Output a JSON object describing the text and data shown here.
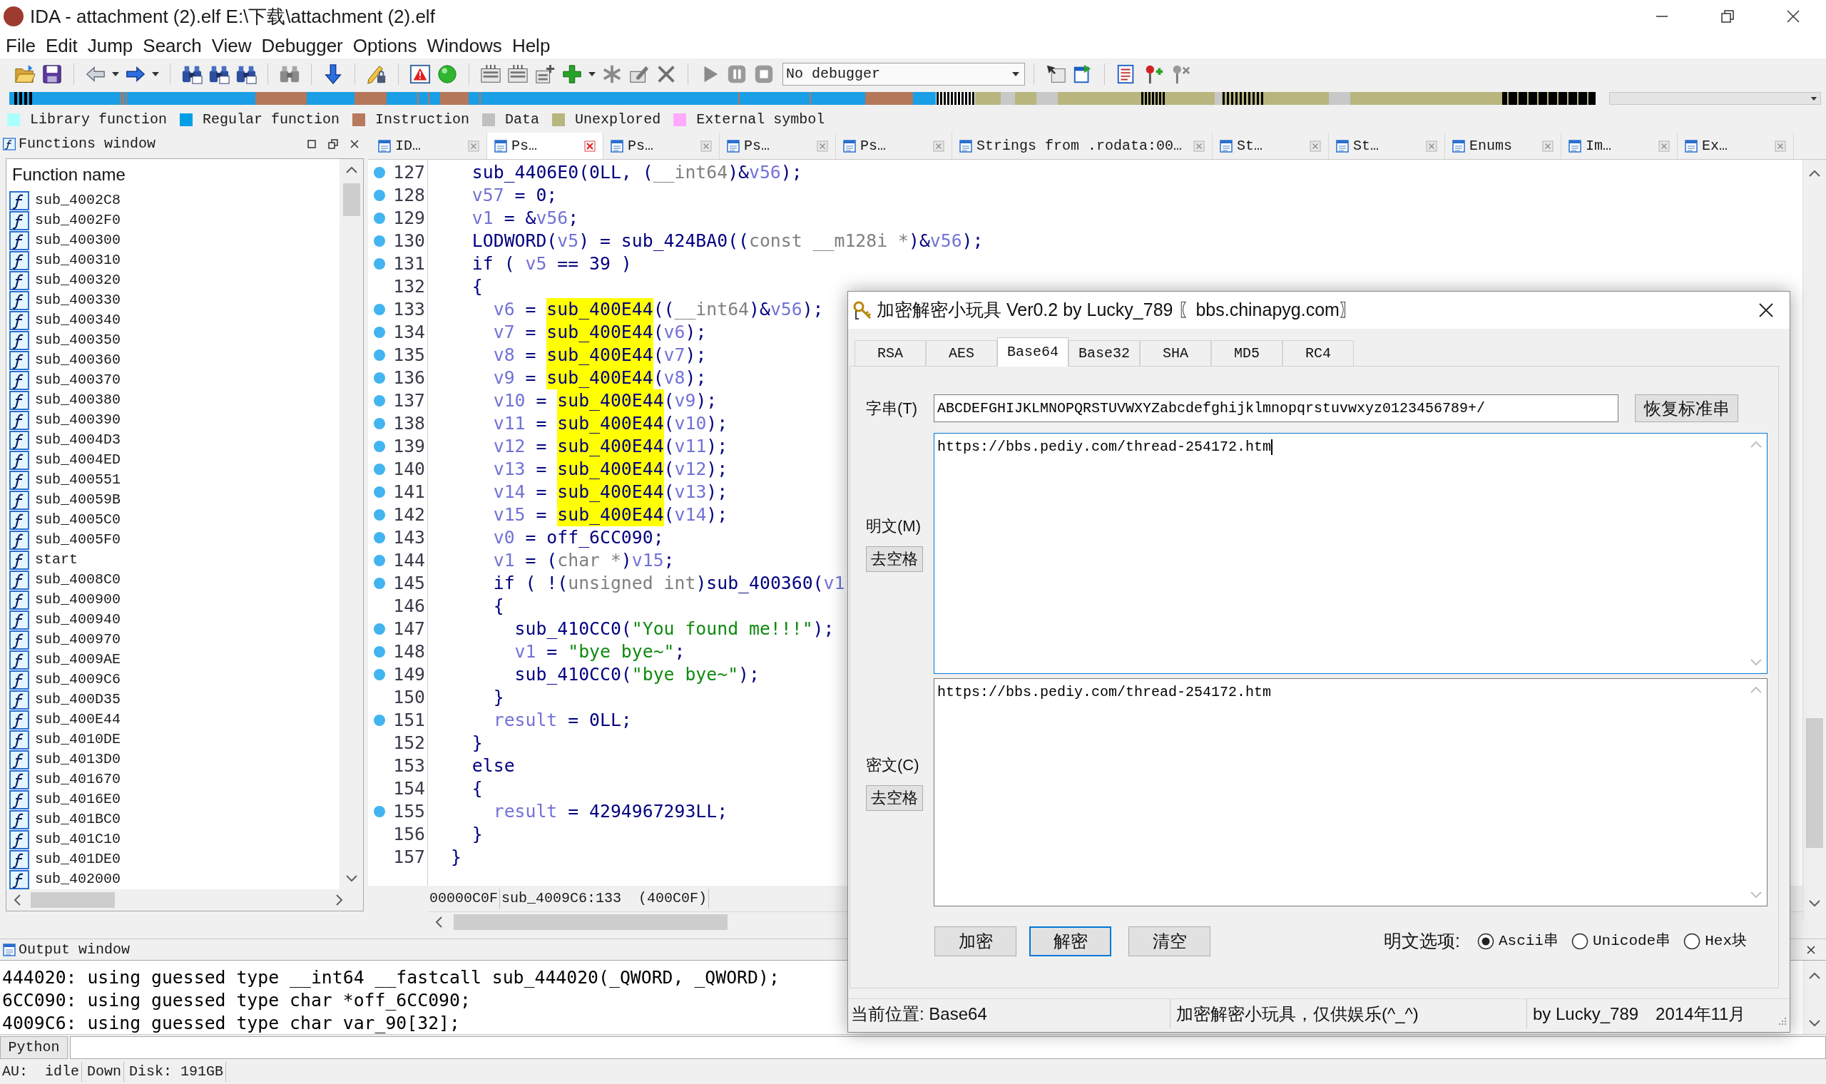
{
  "window": {
    "title": "IDA - attachment (2).elf E:\\下载\\attachment (2).elf"
  },
  "menu": [
    "File",
    "Edit",
    "Jump",
    "Search",
    "View",
    "Debugger",
    "Options",
    "Windows",
    "Help"
  ],
  "toolbar": {
    "debugger": "No debugger"
  },
  "legend": [
    {
      "label": "Library function",
      "color": "#aaffff"
    },
    {
      "label": "Regular function",
      "color": "#009fe6"
    },
    {
      "label": "Instruction",
      "color": "#b87a5e"
    },
    {
      "label": "Data",
      "color": "#c0c0c0"
    },
    {
      "label": "Unexplored",
      "color": "#b8b67e"
    },
    {
      "label": "External symbol",
      "color": "#ffaaff"
    }
  ],
  "functions_window": {
    "title": "Functions window",
    "column": "Function name",
    "items": [
      "sub_4002C8",
      "sub_4002F0",
      "sub_400300",
      "sub_400310",
      "sub_400320",
      "sub_400330",
      "sub_400340",
      "sub_400350",
      "sub_400360",
      "sub_400370",
      "sub_400380",
      "sub_400390",
      "sub_4004D3",
      "sub_4004ED",
      "sub_400551",
      "sub_40059B",
      "sub_4005C0",
      "sub_4005F0",
      "start",
      "sub_4008C0",
      "sub_400900",
      "sub_400940",
      "sub_400970",
      "sub_4009AE",
      "sub_4009C6",
      "sub_400D35",
      "sub_400E44",
      "sub_4010DE",
      "sub_4013D0",
      "sub_401670",
      "sub_4016E0",
      "sub_401BC0",
      "sub_401C10",
      "sub_401DE0",
      "sub_402000"
    ]
  },
  "tabs": [
    {
      "label": "ID…",
      "selected": false
    },
    {
      "label": "Ps…",
      "selected": true
    },
    {
      "label": "Ps…",
      "selected": false
    },
    {
      "label": "Ps…",
      "selected": false
    },
    {
      "label": "Ps…",
      "selected": false
    },
    {
      "label": "Strings from .rodata:00…",
      "selected": false
    },
    {
      "label": "St…",
      "selected": false
    },
    {
      "label": "St…",
      "selected": false
    },
    {
      "label": "Enums",
      "selected": false
    },
    {
      "label": "Im…",
      "selected": false
    },
    {
      "label": "Ex…",
      "selected": false
    }
  ],
  "pseudocode": {
    "lines": [
      {
        "number": "127",
        "marked": true,
        "tokens": [
          {
            "text": "  sub_4406E0(0LL, (",
            "kind": "plain"
          },
          {
            "text": "__int64",
            "kind": "type"
          },
          {
            "text": ")&",
            "kind": "plain"
          },
          {
            "text": "v56",
            "kind": "var"
          },
          {
            "text": ");",
            "kind": "plain"
          }
        ]
      },
      {
        "number": "128",
        "marked": true,
        "tokens": [
          {
            "text": "  v57",
            "kind": "var"
          },
          {
            "text": " = 0;",
            "kind": "plain"
          }
        ]
      },
      {
        "number": "129",
        "marked": true,
        "tokens": [
          {
            "text": "  v1",
            "kind": "var"
          },
          {
            "text": " = &",
            "kind": "plain"
          },
          {
            "text": "v56",
            "kind": "var"
          },
          {
            "text": ";",
            "kind": "plain"
          }
        ]
      },
      {
        "number": "130",
        "marked": true,
        "tokens": [
          {
            "text": "  LODWORD(",
            "kind": "plain"
          },
          {
            "text": "v5",
            "kind": "var"
          },
          {
            "text": ") = sub_424BA0((",
            "kind": "plain"
          },
          {
            "text": "const __m128i *",
            "kind": "type"
          },
          {
            "text": ")&",
            "kind": "plain"
          },
          {
            "text": "v56",
            "kind": "var"
          },
          {
            "text": ");",
            "kind": "plain"
          }
        ]
      },
      {
        "number": "131",
        "marked": true,
        "tokens": [
          {
            "text": "  if ( ",
            "kind": "plain"
          },
          {
            "text": "v5",
            "kind": "var"
          },
          {
            "text": " == 39 )",
            "kind": "plain"
          }
        ]
      },
      {
        "number": "132",
        "marked": false,
        "tokens": [
          {
            "text": "  {",
            "kind": "plain"
          }
        ]
      },
      {
        "number": "133",
        "marked": true,
        "tokens": [
          {
            "text": "    v6",
            "kind": "var"
          },
          {
            "text": " = ",
            "kind": "plain"
          },
          {
            "text": "sub_400E44",
            "kind": "highlight"
          },
          {
            "text": "((",
            "kind": "plain"
          },
          {
            "text": "__int64",
            "kind": "type"
          },
          {
            "text": ")&",
            "kind": "plain"
          },
          {
            "text": "v56",
            "kind": "var"
          },
          {
            "text": ");",
            "kind": "plain"
          }
        ]
      },
      {
        "number": "134",
        "marked": true,
        "tokens": [
          {
            "text": "    v7",
            "kind": "var"
          },
          {
            "text": " = ",
            "kind": "plain"
          },
          {
            "text": "sub_400E44",
            "kind": "highlight"
          },
          {
            "text": "(",
            "kind": "plain"
          },
          {
            "text": "v6",
            "kind": "var"
          },
          {
            "text": ");",
            "kind": "plain"
          }
        ]
      },
      {
        "number": "135",
        "marked": true,
        "tokens": [
          {
            "text": "    v8",
            "kind": "var"
          },
          {
            "text": " = ",
            "kind": "plain"
          },
          {
            "text": "sub_400E44",
            "kind": "highlight"
          },
          {
            "text": "(",
            "kind": "plain"
          },
          {
            "text": "v7",
            "kind": "var"
          },
          {
            "text": ");",
            "kind": "plain"
          }
        ]
      },
      {
        "number": "136",
        "marked": true,
        "tokens": [
          {
            "text": "    v9",
            "kind": "var"
          },
          {
            "text": " = ",
            "kind": "plain"
          },
          {
            "text": "sub_400E44",
            "kind": "highlight"
          },
          {
            "text": "(",
            "kind": "plain"
          },
          {
            "text": "v8",
            "kind": "var"
          },
          {
            "text": ");",
            "kind": "plain"
          }
        ]
      },
      {
        "number": "137",
        "marked": true,
        "tokens": [
          {
            "text": "    v10",
            "kind": "var"
          },
          {
            "text": " = ",
            "kind": "plain"
          },
          {
            "text": "sub_400E44",
            "kind": "highlight"
          },
          {
            "text": "(",
            "kind": "plain"
          },
          {
            "text": "v9",
            "kind": "var"
          },
          {
            "text": ");",
            "kind": "plain"
          }
        ]
      },
      {
        "number": "138",
        "marked": true,
        "tokens": [
          {
            "text": "    v11",
            "kind": "var"
          },
          {
            "text": " = ",
            "kind": "plain"
          },
          {
            "text": "sub_400E44",
            "kind": "highlight"
          },
          {
            "text": "(",
            "kind": "plain"
          },
          {
            "text": "v10",
            "kind": "var"
          },
          {
            "text": ");",
            "kind": "plain"
          }
        ]
      },
      {
        "number": "139",
        "marked": true,
        "tokens": [
          {
            "text": "    v12",
            "kind": "var"
          },
          {
            "text": " = ",
            "kind": "plain"
          },
          {
            "text": "sub_400E44",
            "kind": "highlight"
          },
          {
            "text": "(",
            "kind": "plain"
          },
          {
            "text": "v11",
            "kind": "var"
          },
          {
            "text": ");",
            "kind": "plain"
          }
        ]
      },
      {
        "number": "140",
        "marked": true,
        "tokens": [
          {
            "text": "    v13",
            "kind": "var"
          },
          {
            "text": " = ",
            "kind": "plain"
          },
          {
            "text": "sub_400E44",
            "kind": "highlight"
          },
          {
            "text": "(",
            "kind": "plain"
          },
          {
            "text": "v12",
            "kind": "var"
          },
          {
            "text": ");",
            "kind": "plain"
          }
        ]
      },
      {
        "number": "141",
        "marked": true,
        "tokens": [
          {
            "text": "    v14",
            "kind": "var"
          },
          {
            "text": " = ",
            "kind": "plain"
          },
          {
            "text": "sub_400E44",
            "kind": "highlight"
          },
          {
            "text": "(",
            "kind": "plain"
          },
          {
            "text": "v13",
            "kind": "var"
          },
          {
            "text": ");",
            "kind": "plain"
          }
        ]
      },
      {
        "number": "142",
        "marked": true,
        "tokens": [
          {
            "text": "    v15",
            "kind": "var"
          },
          {
            "text": " = ",
            "kind": "plain"
          },
          {
            "text": "sub_400E44",
            "kind": "highlight"
          },
          {
            "text": "(",
            "kind": "plain"
          },
          {
            "text": "v14",
            "kind": "var"
          },
          {
            "text": ");",
            "kind": "plain"
          }
        ]
      },
      {
        "number": "143",
        "marked": true,
        "tokens": [
          {
            "text": "    v0",
            "kind": "var"
          },
          {
            "text": " = off_6CC090;",
            "kind": "plain"
          }
        ]
      },
      {
        "number": "144",
        "marked": true,
        "tokens": [
          {
            "text": "    v1",
            "kind": "var"
          },
          {
            "text": " = (",
            "kind": "plain"
          },
          {
            "text": "char *",
            "kind": "type"
          },
          {
            "text": ")",
            "kind": "plain"
          },
          {
            "text": "v15",
            "kind": "var"
          },
          {
            "text": ";",
            "kind": "plain"
          }
        ]
      },
      {
        "number": "145",
        "marked": true,
        "tokens": [
          {
            "text": "    if ( !(",
            "kind": "plain"
          },
          {
            "text": "unsigned int",
            "kind": "type"
          },
          {
            "text": ")sub_400360(",
            "kind": "plain"
          },
          {
            "text": "v1",
            "kind": "var"
          }
        ]
      },
      {
        "number": "146",
        "marked": false,
        "tokens": [
          {
            "text": "    {",
            "kind": "plain"
          }
        ]
      },
      {
        "number": "147",
        "marked": true,
        "tokens": [
          {
            "text": "      sub_410CC0(",
            "kind": "plain"
          },
          {
            "text": "\"You found me!!!\"",
            "kind": "string"
          },
          {
            "text": ");",
            "kind": "plain"
          }
        ]
      },
      {
        "number": "148",
        "marked": true,
        "tokens": [
          {
            "text": "      v1",
            "kind": "var"
          },
          {
            "text": " = ",
            "kind": "plain"
          },
          {
            "text": "\"bye bye~\"",
            "kind": "string"
          },
          {
            "text": ";",
            "kind": "plain"
          }
        ]
      },
      {
        "number": "149",
        "marked": true,
        "tokens": [
          {
            "text": "      sub_410CC0(",
            "kind": "plain"
          },
          {
            "text": "\"bye bye~\"",
            "kind": "string"
          },
          {
            "text": ");",
            "kind": "plain"
          }
        ]
      },
      {
        "number": "150",
        "marked": false,
        "tokens": [
          {
            "text": "    }",
            "kind": "plain"
          }
        ]
      },
      {
        "number": "151",
        "marked": true,
        "tokens": [
          {
            "text": "    result",
            "kind": "var"
          },
          {
            "text": " = 0LL;",
            "kind": "plain"
          }
        ]
      },
      {
        "number": "152",
        "marked": false,
        "tokens": [
          {
            "text": "  }",
            "kind": "plain"
          }
        ]
      },
      {
        "number": "153",
        "marked": false,
        "tokens": [
          {
            "text": "  else",
            "kind": "plain"
          }
        ]
      },
      {
        "number": "154",
        "marked": false,
        "tokens": [
          {
            "text": "  {",
            "kind": "plain"
          }
        ]
      },
      {
        "number": "155",
        "marked": true,
        "tokens": [
          {
            "text": "    result",
            "kind": "var"
          },
          {
            "text": " = 4294967293LL;",
            "kind": "plain"
          }
        ]
      },
      {
        "number": "156",
        "marked": false,
        "tokens": [
          {
            "text": "  }",
            "kind": "plain"
          }
        ]
      },
      {
        "number": "157",
        "marked": false,
        "tokens": [
          {
            "text": "}",
            "kind": "plain"
          }
        ]
      }
    ],
    "status": [
      "00000C0F",
      "sub_4009C6:133  (400C0F)"
    ]
  },
  "output_window": {
    "title": "Output window",
    "lines": [
      "444020: using guessed type __int64 __fastcall sub_444020(_QWORD, _QWORD);",
      "6CC090: using guessed type char *off_6CC090;",
      "4009C6: using guessed type char var_90[32];"
    ]
  },
  "python": {
    "button": "Python"
  },
  "status_bar": [
    "AU:  idle",
    "Down",
    "Disk: 191GB"
  ],
  "dialog": {
    "title": "加密解密小玩具 Ver0.2 by Lucky_789 〖bbs.chinapyg.com〗",
    "tabs": [
      {
        "label": "RSA",
        "selected": false
      },
      {
        "label": "AES",
        "selected": false
      },
      {
        "label": "Base64",
        "selected": true
      },
      {
        "label": "Base32",
        "selected": false
      },
      {
        "label": "SHA",
        "selected": false
      },
      {
        "label": "MD5",
        "selected": false
      },
      {
        "label": "RC4",
        "selected": false
      }
    ],
    "alphabet": {
      "label": "字串(T)",
      "value": "ABCDEFGHIJKLMNOPQRSTUVWXYZabcdefghijklmnopqrstuvwxyz0123456789+/",
      "button": "恢复标准串"
    },
    "plaintext": {
      "label": "明文(M)",
      "value": "https://bbs.pediy.com/thread-254172.htm",
      "focused": true,
      "button": "去空格"
    },
    "ciphertext": {
      "label": "密文(C)",
      "value": "https://bbs.pediy.com/thread-254172.htm",
      "focused": false,
      "button": "去空格"
    },
    "buttons": [
      {
        "label": "加密",
        "focused": false
      },
      {
        "label": "解密",
        "focused": true
      },
      {
        "label": "清空",
        "focused": false
      }
    ],
    "options": {
      "label": "明文选项:",
      "choices": [
        {
          "label": "Ascii串",
          "selected": true
        },
        {
          "label": "Unicode串",
          "selected": false
        },
        {
          "label": "Hex块",
          "selected": false
        }
      ]
    },
    "status_bar": [
      "当前位置: Base64",
      "加密解密小玩具，仅供娱乐(^_^)",
      "by Lucky_789",
      "2014年11月"
    ]
  }
}
